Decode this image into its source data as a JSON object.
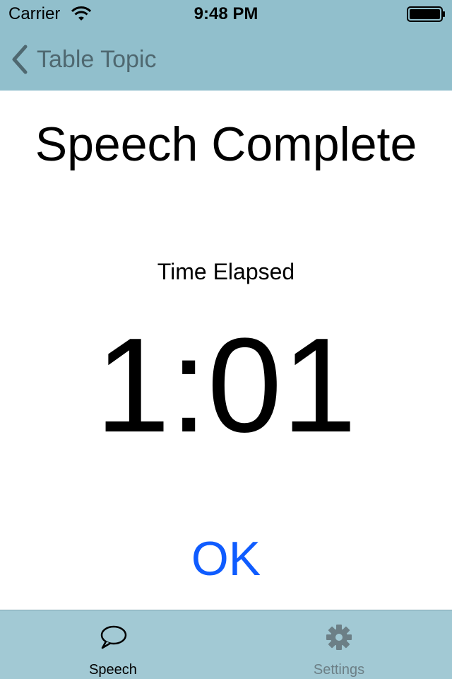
{
  "colors": {
    "nav_background": "#91bfcc",
    "tab_background": "#a2c9d4",
    "accent": "#0f5cff",
    "back_label": "#4f6870",
    "tab_inactive": "#6c7f86"
  },
  "status_bar": {
    "carrier": "Carrier",
    "time": "9:48 PM",
    "icons": [
      "wifi-icon",
      "battery-icon"
    ]
  },
  "nav": {
    "back_label": "Table Topic",
    "back_icon": "chevron-left-icon"
  },
  "main": {
    "title": "Speech Complete",
    "elapsed_label": "Time Elapsed",
    "elapsed_value": "1:01",
    "ok_label": "OK"
  },
  "tabs": [
    {
      "label": "Speech",
      "icon": "speech-bubble-icon",
      "selected": true
    },
    {
      "label": "Settings",
      "icon": "gear-icon",
      "selected": false
    }
  ]
}
